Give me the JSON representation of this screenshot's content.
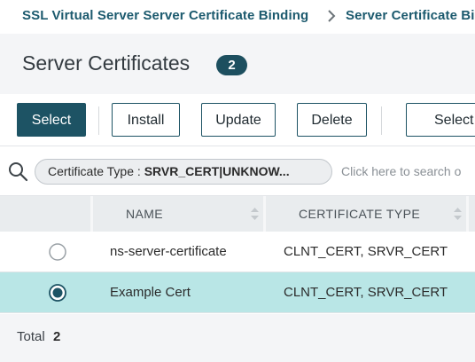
{
  "breadcrumb": {
    "items": [
      "SSL Virtual Server Server Certificate Binding",
      "Server Certificate Bi"
    ]
  },
  "header": {
    "title": "Server Certificates",
    "count": "2"
  },
  "toolbar": {
    "select_label": "Select",
    "install_label": "Install",
    "update_label": "Update",
    "delete_label": "Delete",
    "select_right_label": "Select"
  },
  "search": {
    "chip_key": "Certificate Type :",
    "chip_value": "SRVR_CERT|UNKNOW...",
    "placeholder": "Click here to search o"
  },
  "table": {
    "columns": [
      "NAME",
      "CERTIFICATE TYPE"
    ],
    "rows": [
      {
        "name": "ns-server-certificate",
        "certificate_type": "CLNT_CERT, SRVR_CERT",
        "selected": false
      },
      {
        "name": "Example Cert",
        "certificate_type": "CLNT_CERT, SRVR_CERT",
        "selected": true
      }
    ]
  },
  "footer": {
    "total_label": "Total",
    "total_value": "2"
  },
  "colors": {
    "accent": "#1d5364",
    "selected_row": "#b9e6e6",
    "breadcrumb_text": "#1c5a6e"
  },
  "icons": [
    "chevron-right-icon",
    "search-icon",
    "sort-icon",
    "radio-unselected-icon",
    "radio-selected-icon"
  ]
}
